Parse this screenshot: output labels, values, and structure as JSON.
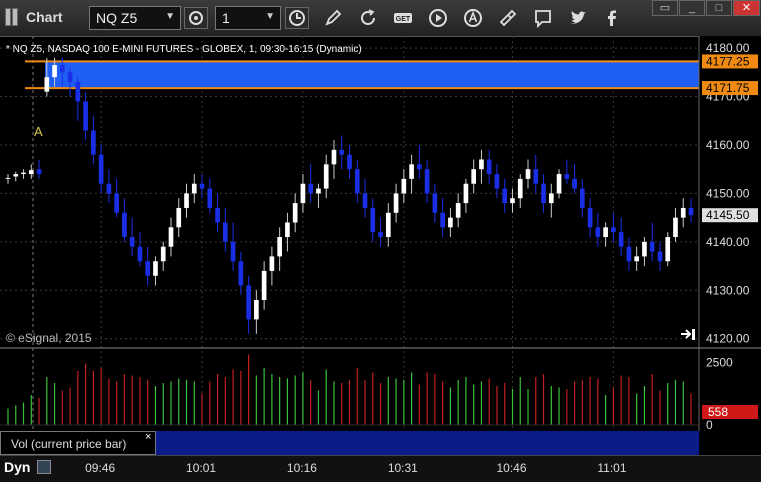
{
  "window": {
    "title": "Chart"
  },
  "toolbar": {
    "symbol_value": "NQ Z5",
    "interval_value": "1",
    "icons": [
      "settings-gear-icon",
      "clock-icon",
      "pencil-icon",
      "refresh-icon",
      "get-icon",
      "play-icon",
      "alert-icon",
      "link-icon",
      "comment-icon",
      "twitter-icon",
      "facebook-icon"
    ]
  },
  "statusbar": {
    "label": "Dyn"
  },
  "volume_panel": {
    "label": "Vol (current price bar)",
    "close_label": "×"
  },
  "copyright": "© eSignal, 2015",
  "colors": {
    "up": "#ffffff",
    "down": "#1a2ee6",
    "zone": "#1f5ef5",
    "zone_line": "#f08a12",
    "vol_up": "#3cc23c",
    "vol_down": "#c21f1f",
    "price_label_bg": "#e0e0e0"
  },
  "chart_data": [
    {
      "type": "candlestick",
      "title": "* NQ Z5, NASDAQ 100 E-MINI FUTURES - GLOBEX, 1, 09:30-16:15 (Dynamic)",
      "x_ticks": [
        "09:46",
        "10:01",
        "10:16",
        "10:31",
        "10:46",
        "11:01"
      ],
      "y_ticks": [
        4120,
        4130,
        4140,
        4150,
        4160,
        4170,
        4180
      ],
      "ylim": [
        4118.5,
        4182.5
      ],
      "grid": true,
      "zone": {
        "low": 4171.75,
        "high": 4177.25,
        "labels": [
          "4177.25",
          "4171.75"
        ]
      },
      "last_price": {
        "value": 4145.5,
        "label": "4145.50"
      },
      "annotation": "A",
      "candles": [
        [
          4153,
          4154,
          4152,
          4153.2
        ],
        [
          4153.5,
          4154.5,
          4152.5,
          4154
        ],
        [
          4154,
          4155,
          4153,
          4154.3
        ],
        [
          4154,
          4156,
          4153,
          4154.8
        ],
        [
          4155,
          4157,
          4153,
          4154
        ],
        [
          4171,
          4178,
          4170,
          4174
        ],
        [
          4174,
          4178,
          4172,
          4176.5
        ],
        [
          4176.5,
          4178,
          4172,
          4175
        ],
        [
          4175,
          4176,
          4170,
          4173
        ],
        [
          4173,
          4174,
          4165,
          4169
        ],
        [
          4169,
          4171,
          4161,
          4163
        ],
        [
          4163,
          4166,
          4156,
          4158
        ],
        [
          4158,
          4160,
          4150,
          4152
        ],
        [
          4152,
          4155,
          4148,
          4150
        ],
        [
          4150,
          4153,
          4145,
          4146
        ],
        [
          4146,
          4149,
          4140,
          4141
        ],
        [
          4141,
          4145,
          4137,
          4139
        ],
        [
          4139,
          4142,
          4135,
          4136
        ],
        [
          4136,
          4139,
          4131,
          4133
        ],
        [
          4133,
          4137,
          4131,
          4136
        ],
        [
          4136,
          4140,
          4134,
          4139
        ],
        [
          4139,
          4145,
          4137,
          4143
        ],
        [
          4143,
          4149,
          4141,
          4147
        ],
        [
          4147,
          4152,
          4145,
          4150
        ],
        [
          4150,
          4154,
          4148,
          4152
        ],
        [
          4152,
          4154,
          4149,
          4151
        ],
        [
          4151,
          4153,
          4146,
          4147
        ],
        [
          4147,
          4150,
          4142,
          4144
        ],
        [
          4144,
          4147,
          4138,
          4140
        ],
        [
          4140,
          4144,
          4134,
          4136
        ],
        [
          4136,
          4138,
          4129,
          4131
        ],
        [
          4131,
          4133,
          4121,
          4124
        ],
        [
          4124,
          4130,
          4121,
          4128
        ],
        [
          4128,
          4136,
          4126,
          4134
        ],
        [
          4134,
          4139,
          4131,
          4137
        ],
        [
          4137,
          4143,
          4134,
          4141
        ],
        [
          4141,
          4146,
          4138,
          4144
        ],
        [
          4144,
          4150,
          4142,
          4148
        ],
        [
          4148,
          4154,
          4146,
          4152
        ],
        [
          4152,
          4156,
          4148,
          4150
        ],
        [
          4150,
          4152,
          4147,
          4151
        ],
        [
          4151,
          4158,
          4149,
          4156
        ],
        [
          4156,
          4161,
          4153,
          4159
        ],
        [
          4159,
          4162,
          4155,
          4158
        ],
        [
          4158,
          4160,
          4153,
          4155
        ],
        [
          4155,
          4157,
          4148,
          4150
        ],
        [
          4150,
          4153,
          4145,
          4147
        ],
        [
          4147,
          4149,
          4140,
          4142
        ],
        [
          4142,
          4145,
          4139,
          4141
        ],
        [
          4141,
          4148,
          4139,
          4146
        ],
        [
          4146,
          4152,
          4144,
          4150
        ],
        [
          4150,
          4155,
          4148,
          4153
        ],
        [
          4153,
          4158,
          4150,
          4156
        ],
        [
          4156,
          4160,
          4153,
          4155
        ],
        [
          4155,
          4157,
          4148,
          4150
        ],
        [
          4150,
          4152,
          4144,
          4146
        ],
        [
          4146,
          4149,
          4141,
          4143
        ],
        [
          4143,
          4147,
          4141,
          4145
        ],
        [
          4145,
          4150,
          4143,
          4148
        ],
        [
          4148,
          4153,
          4146,
          4152
        ],
        [
          4152,
          4157,
          4150,
          4155
        ],
        [
          4155,
          4159,
          4152,
          4157
        ],
        [
          4157,
          4159,
          4152,
          4154
        ],
        [
          4154,
          4156,
          4149,
          4151
        ],
        [
          4151,
          4153,
          4146,
          4148
        ],
        [
          4148,
          4151,
          4146,
          4149
        ],
        [
          4149,
          4154,
          4147,
          4153
        ],
        [
          4153,
          4157,
          4151,
          4155
        ],
        [
          4155,
          4158,
          4150,
          4152
        ],
        [
          4152,
          4154,
          4146,
          4148
        ],
        [
          4148,
          4152,
          4145,
          4150
        ],
        [
          4150,
          4155,
          4149,
          4154
        ],
        [
          4154,
          4157,
          4152,
          4153
        ],
        [
          4153,
          4156,
          4150,
          4151
        ],
        [
          4151,
          4153,
          4145,
          4147
        ],
        [
          4147,
          4149,
          4141,
          4143
        ],
        [
          4143,
          4146,
          4139,
          4141
        ],
        [
          4141,
          4144,
          4139,
          4143
        ],
        [
          4143,
          4146,
          4140,
          4142
        ],
        [
          4142,
          4145,
          4137,
          4139
        ],
        [
          4139,
          4141,
          4134,
          4136
        ],
        [
          4136,
          4139,
          4134,
          4137
        ],
        [
          4137,
          4141,
          4135,
          4140
        ],
        [
          4140,
          4144,
          4136,
          4138
        ],
        [
          4138,
          4140,
          4134,
          4136
        ],
        [
          4136,
          4142,
          4135,
          4141
        ],
        [
          4141,
          4147,
          4140,
          4145
        ],
        [
          4145,
          4149,
          4143,
          4147
        ],
        [
          4147,
          4149,
          4144,
          4145.5
        ]
      ],
      "volume_ylim": [
        0,
        3000
      ],
      "volume_ticks": [
        "2500",
        "0"
      ],
      "volume_last_label": "558"
    }
  ]
}
